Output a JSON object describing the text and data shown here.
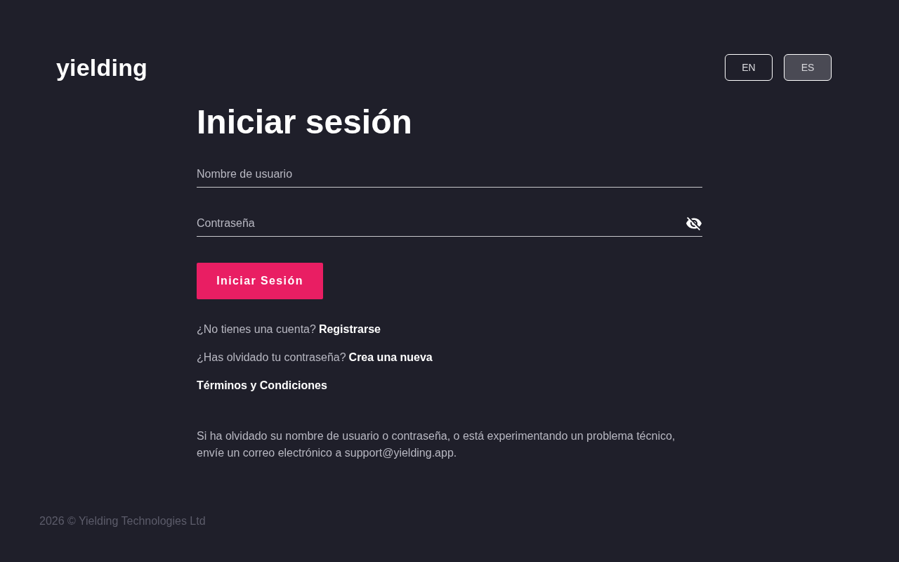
{
  "header": {
    "logo": "yielding",
    "languages": [
      {
        "label": "EN",
        "selected": false
      },
      {
        "label": "ES",
        "selected": true
      }
    ]
  },
  "title": "Iniciar sesión",
  "fields": [
    {
      "kind": "text",
      "placeholder": "Nombre de usuario"
    },
    {
      "kind": "password",
      "placeholder": "Contraseña"
    }
  ],
  "submit_button": "Iniciar Sesión",
  "links": [
    {
      "prompt": "¿No tienes una cuenta?",
      "link": "Registrarse"
    },
    {
      "prompt": "¿Has olvidado tu contraseña?",
      "link": "Crea una nueva"
    },
    {
      "link": "Términos y Condiciones"
    }
  ],
  "help_text": "Si ha olvidado su nombre de usuario o contraseña, o está experimentando un problema técnico, envíe un correo electrónico a support@yielding.app.",
  "footer": "2026 © Yielding Technologies Ltd"
}
